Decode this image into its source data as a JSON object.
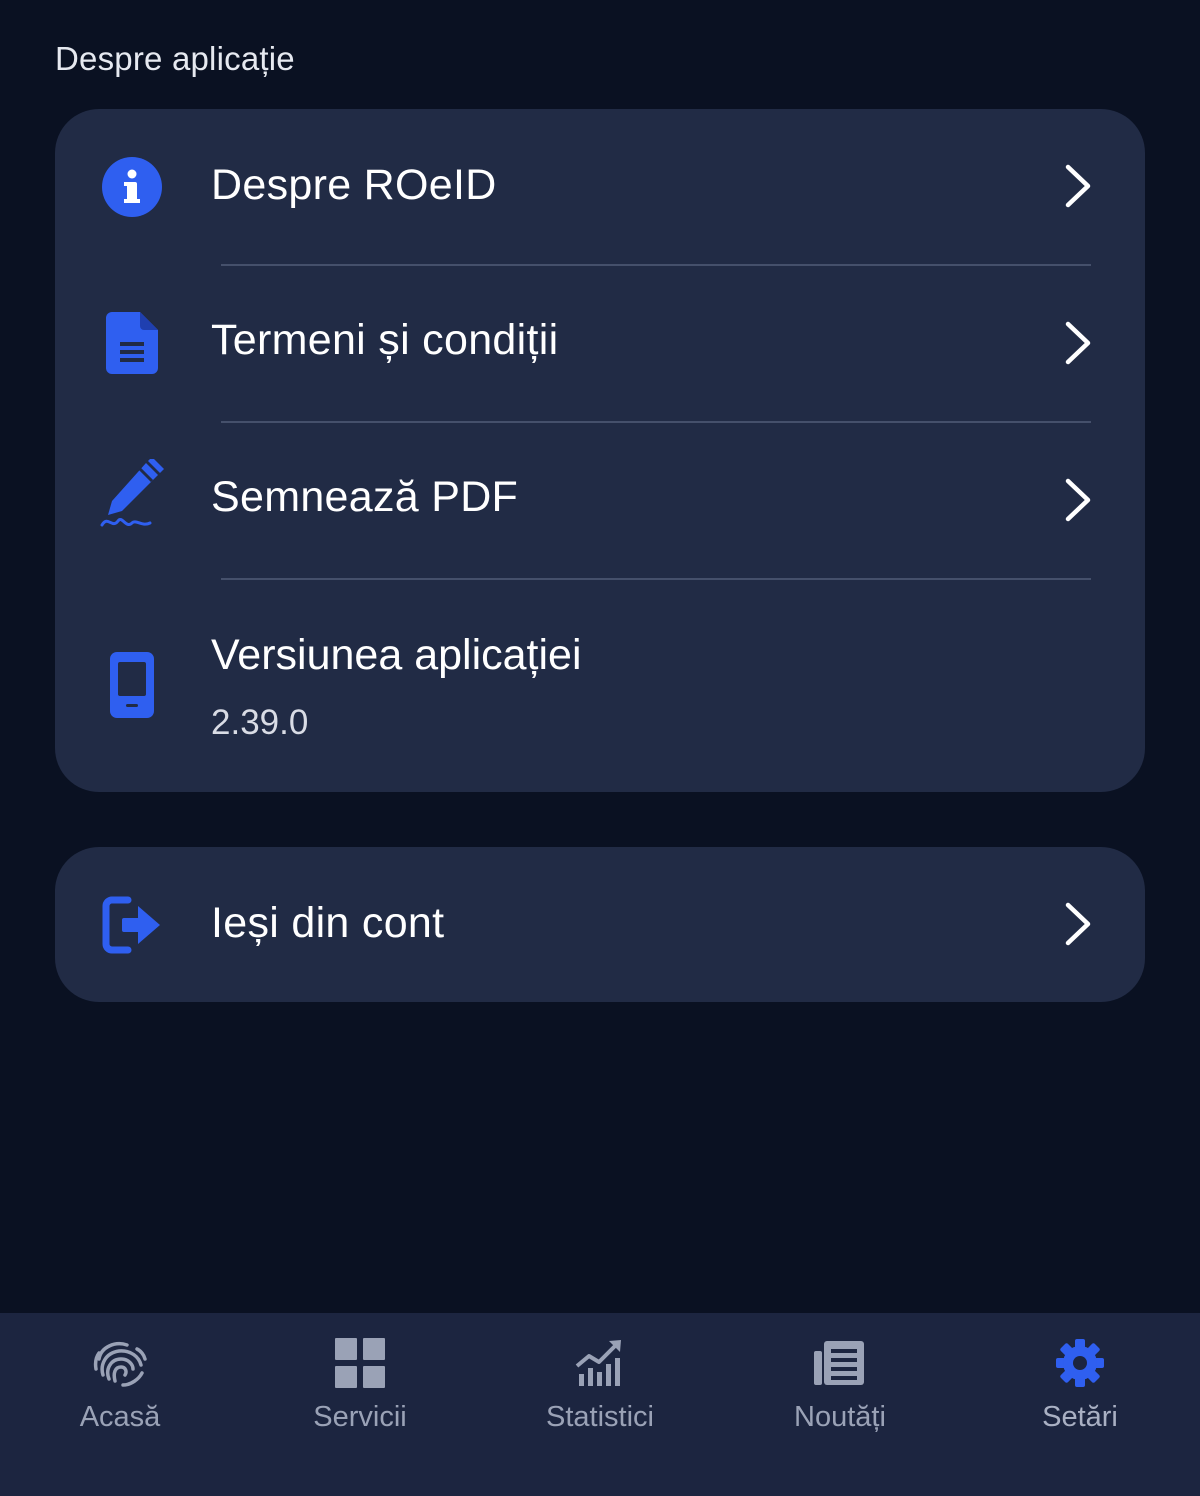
{
  "section": {
    "title": "Despre aplicație"
  },
  "about_card": {
    "items": [
      {
        "label": "Despre ROeID",
        "icon": "info-icon"
      },
      {
        "label": "Termeni și condiții",
        "icon": "document-icon"
      },
      {
        "label": "Semnează PDF",
        "icon": "pen-signature-icon"
      }
    ],
    "version": {
      "label": "Versiunea aplicației",
      "value": "2.39.0",
      "icon": "phone-icon"
    }
  },
  "logout_card": {
    "label": "Ieși din cont",
    "icon": "logout-icon"
  },
  "tabbar": {
    "tabs": [
      {
        "label": "Acasă",
        "icon": "fingerprint-icon"
      },
      {
        "label": "Servicii",
        "icon": "grid-icon"
      },
      {
        "label": "Statistici",
        "icon": "stats-icon"
      },
      {
        "label": "Noutăți",
        "icon": "newspaper-icon"
      },
      {
        "label": "Setări",
        "icon": "gear-icon"
      }
    ],
    "active_tab": "Setări"
  },
  "colors": {
    "background": "#0a1122",
    "card": "#212b45",
    "accent": "#2f5ff0",
    "tab_inactive": "#9aa2b6"
  }
}
